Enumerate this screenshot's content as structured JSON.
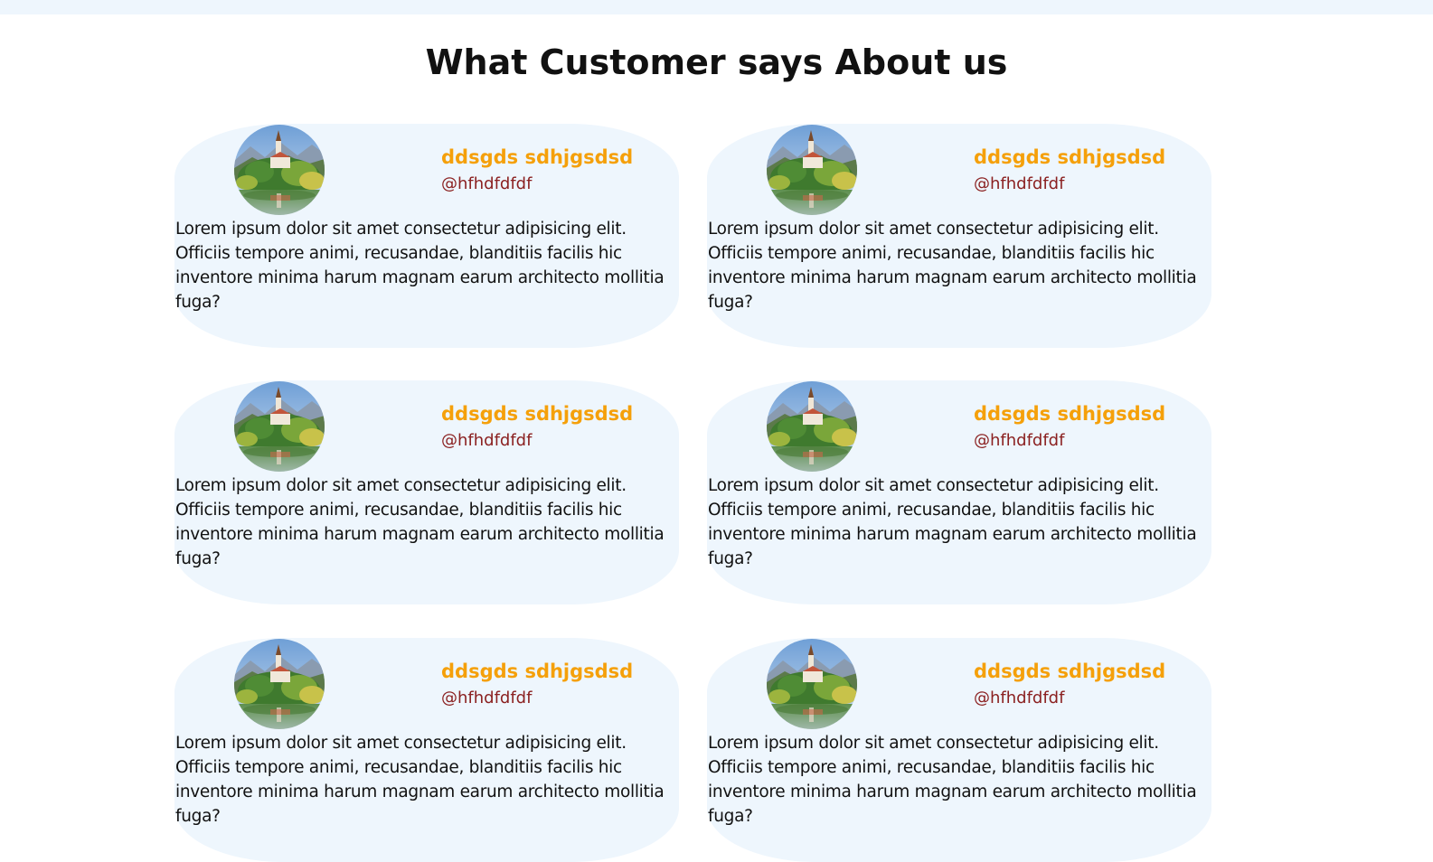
{
  "heading": "What Customer says About us",
  "testimonials": [
    {
      "name": "ddsgds sdhjgsdsd",
      "handle": "@hfhdfdfdf",
      "text": "Lorem ipsum dolor sit amet consectetur adipisicing elit. Officiis tempore animi, recusandae, blanditiis facilis hic inventore minima harum magnam earum architecto mollitia fuga?",
      "avatar": "landscape-castle-lake-image"
    },
    {
      "name": "ddsgds sdhjgsdsd",
      "handle": "@hfhdfdfdf",
      "text": "Lorem ipsum dolor sit amet consectetur adipisicing elit. Officiis tempore animi, recusandae, blanditiis facilis hic inventore minima harum magnam earum architecto mollitia fuga?",
      "avatar": "landscape-castle-lake-image"
    },
    {
      "name": "ddsgds sdhjgsdsd",
      "handle": "@hfhdfdfdf",
      "text": "Lorem ipsum dolor sit amet consectetur adipisicing elit. Officiis tempore animi, recusandae, blanditiis facilis hic inventore minima harum magnam earum architecto mollitia fuga?",
      "avatar": "landscape-castle-lake-image"
    },
    {
      "name": "ddsgds sdhjgsdsd",
      "handle": "@hfhdfdfdf",
      "text": "Lorem ipsum dolor sit amet consectetur adipisicing elit. Officiis tempore animi, recusandae, blanditiis facilis hic inventore minima harum magnam earum architecto mollitia fuga?",
      "avatar": "landscape-castle-lake-image"
    },
    {
      "name": "ddsgds sdhjgsdsd",
      "handle": "@hfhdfdfdf",
      "text": "Lorem ipsum dolor sit amet consectetur adipisicing elit. Officiis tempore animi, recusandae, blanditiis facilis hic inventore minima harum magnam earum architecto mollitia fuga?",
      "avatar": "landscape-castle-lake-image"
    },
    {
      "name": "ddsgds sdhjgsdsd",
      "handle": "@hfhdfdfdf",
      "text": "Lorem ipsum dolor sit amet consectetur adipisicing elit. Officiis tempore animi, recusandae, blanditiis facilis hic inventore minima harum magnam earum architecto mollitia fuga?",
      "avatar": "landscape-castle-lake-image"
    }
  ],
  "colors": {
    "card_background": "#eef6fd",
    "name": "#f5a00a",
    "handle": "#8b2121",
    "text": "#111111"
  }
}
